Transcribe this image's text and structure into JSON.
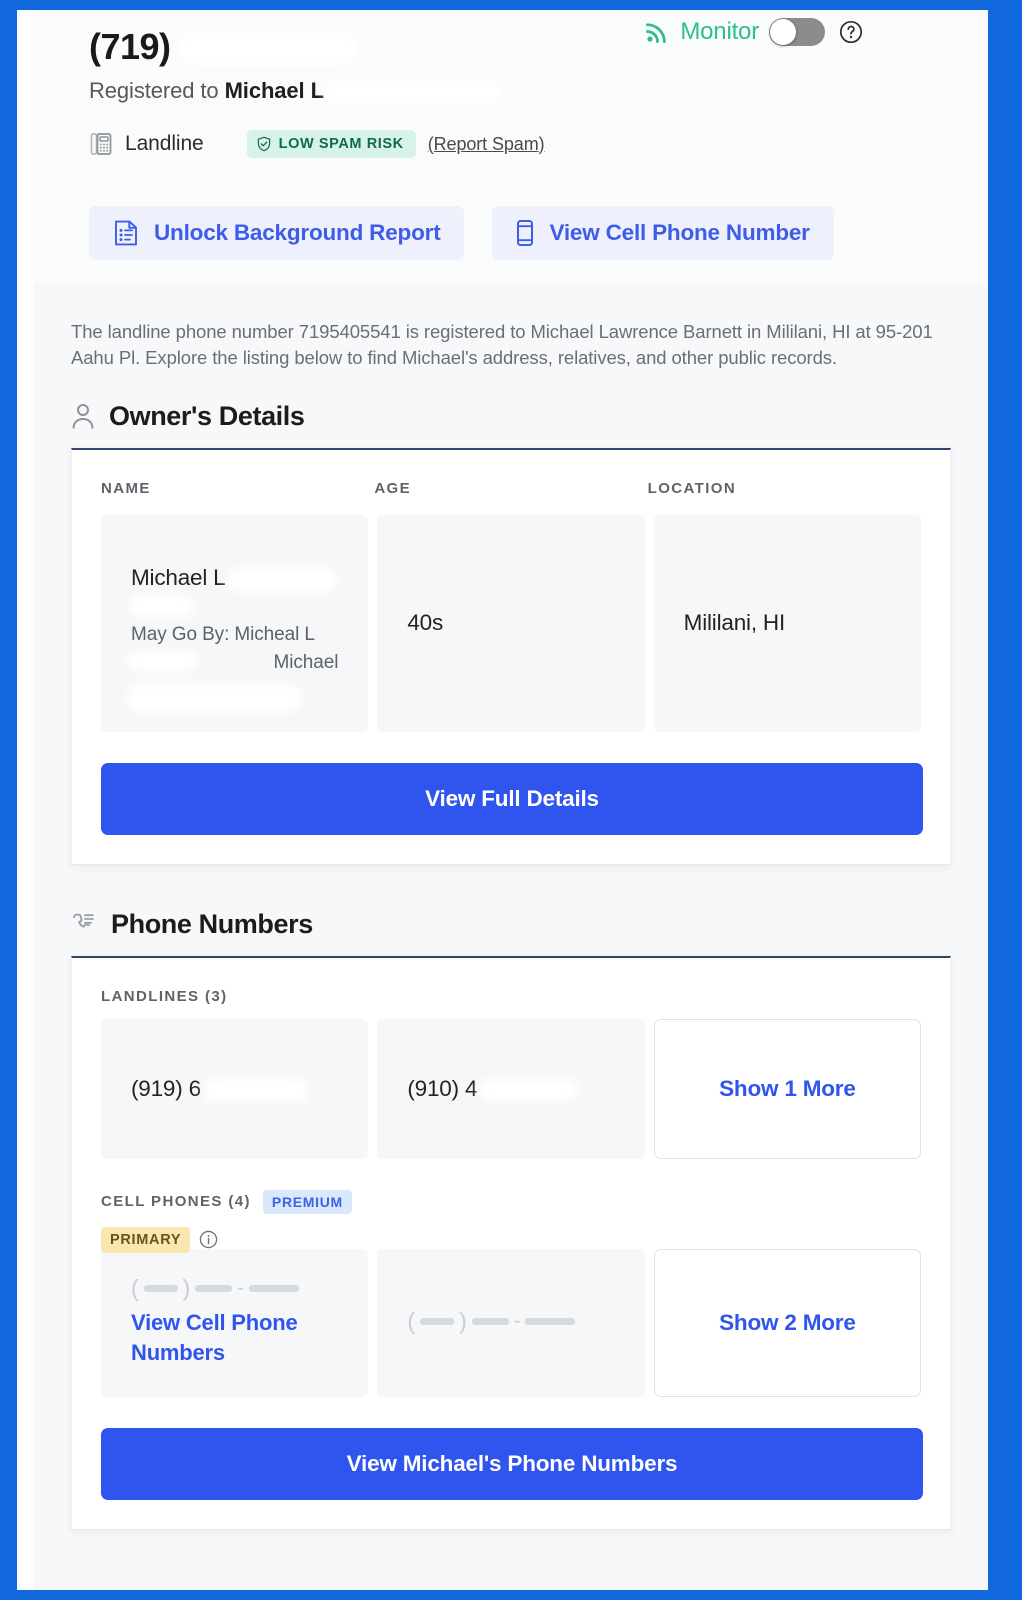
{
  "theme": {
    "frame_blue": "#1068dc",
    "accent_blue": "#2f55ee",
    "link_blue": "#3e5ce8",
    "monitor_green": "#2fbe8e",
    "spam_badge_bg": "#d7f2e6",
    "spam_badge_text": "#0d6b4c",
    "premium_badge_bg": "#d9e8fb",
    "primary_badge_bg": "#fae6b0"
  },
  "header": {
    "monitor_label": "Monitor",
    "monitor_toggle_state": "off",
    "rss_icon": "signal-broadcast-icon",
    "help_icon": "help-circle-icon",
    "phone_area_code": "(719)",
    "registered_prefix": "Registered to ",
    "registered_name": "Michael L",
    "line_type": "Landline",
    "line_type_icon": "desk-phone-icon",
    "spam_badge": "LOW SPAM RISK",
    "spam_badge_icon": "shield-check-icon",
    "report_spam_link": "(Report Spam)",
    "buttons": [
      {
        "label": "Unlock Background Report",
        "icon": "report-document-icon"
      },
      {
        "label": "View Cell Phone Number",
        "icon": "mobile-phone-icon"
      }
    ]
  },
  "description": "The landline phone number 7195405541 is registered to Michael Lawrence Barnett in Mililani, HI at 95-201 Aahu Pl. Explore the listing below to find Michael's address, relatives, and other public records.",
  "owner_section": {
    "title": "Owner's Details",
    "icon": "user-outline-icon",
    "columns": [
      "NAME",
      "AGE",
      "LOCATION"
    ],
    "name_value": "Michael L",
    "name_alias_line1": "May Go By: Micheal L",
    "name_alias_line2": "Michael",
    "age_value": "40s",
    "location_value": "Mililani, HI",
    "cta_label": "View Full Details"
  },
  "phone_section": {
    "title": "Phone Numbers",
    "icon": "phone-list-icon",
    "landlines_label": "LANDLINES (3)",
    "landlines": [
      {
        "number": "(919) 6"
      },
      {
        "number": "(910) 4"
      }
    ],
    "landlines_show_more": "Show 1 More",
    "cell_label": "CELL PHONES (4)",
    "premium_badge": "PREMIUM",
    "primary_badge": "PRIMARY",
    "primary_info_icon": "info-circle-icon",
    "cell_view_link": "View Cell Phone Numbers",
    "cell_show_more": "Show 2 More",
    "cta_label": "View Michael's Phone Numbers"
  }
}
